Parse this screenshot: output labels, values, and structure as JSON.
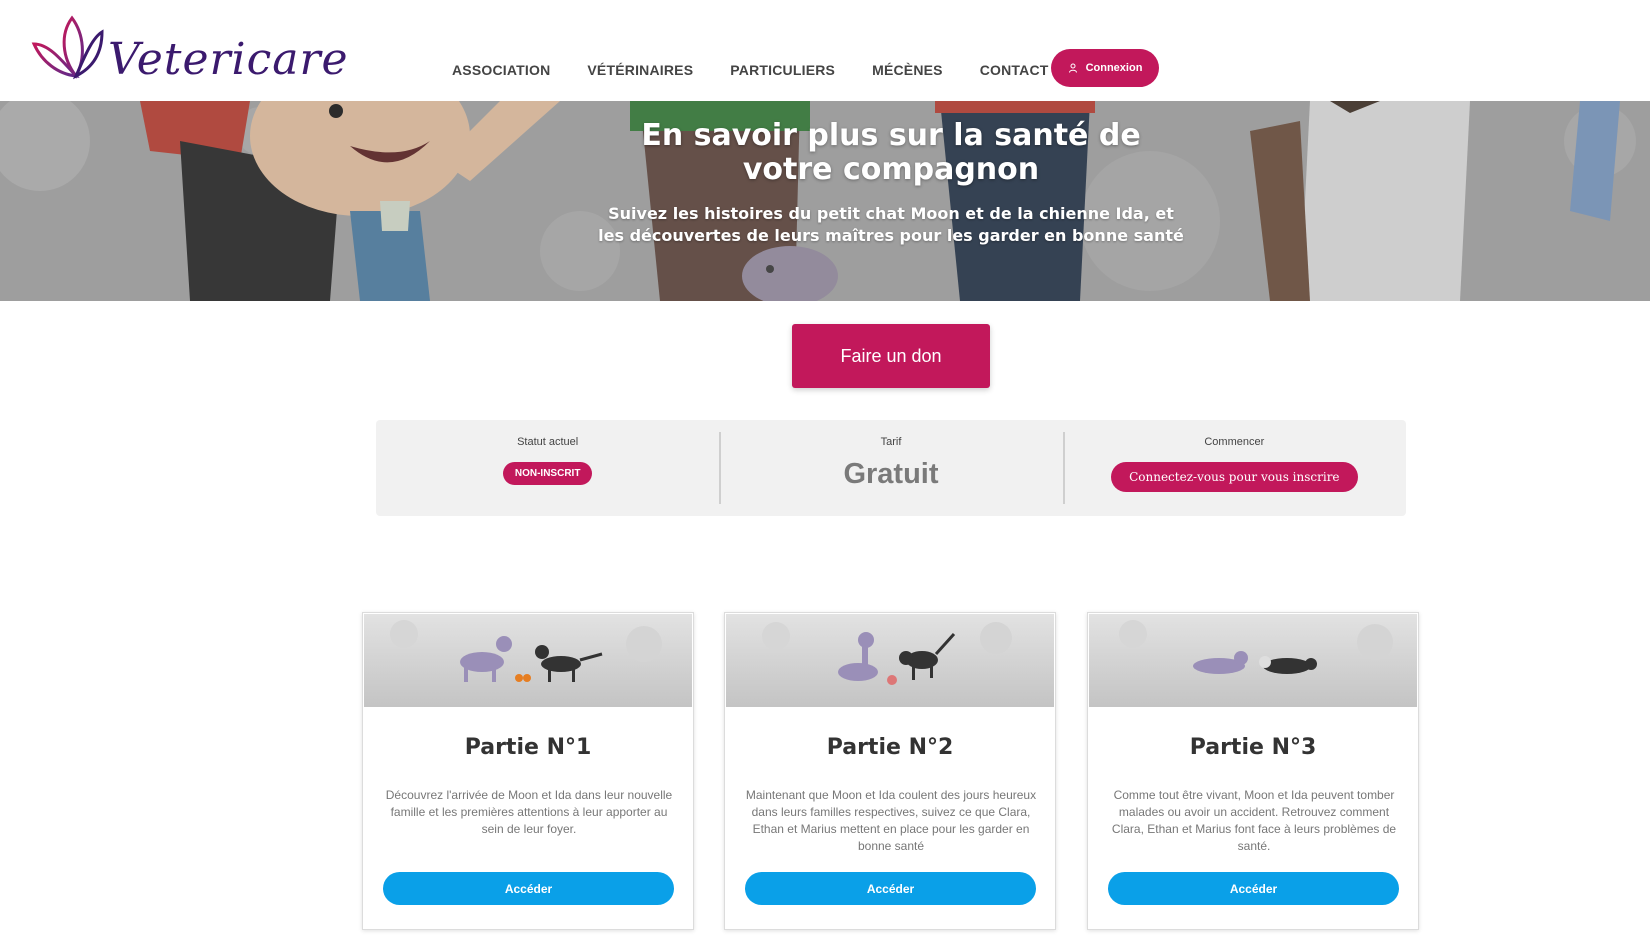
{
  "header": {
    "logo_text": "Vetericare",
    "nav": [
      {
        "label": "ASSOCIATION"
      },
      {
        "label": "VÉTÉRINAIRES"
      },
      {
        "label": "PARTICULIERS"
      },
      {
        "label": "MÉCÈNES"
      },
      {
        "label": "CONTACT"
      }
    ],
    "login_label": "Connexion",
    "login_icon": "user-icon"
  },
  "hero": {
    "title_line1": "En savoir plus sur la santé de",
    "title_line2": "votre compagnon",
    "subtitle_line1": "Suivez les histoires du petit chat Moon et de la chienne Ida, et",
    "subtitle_line2": "les découvertes de leurs maîtres pour les garder en bonne santé"
  },
  "donate_label": "Faire un don",
  "status": {
    "current_label": "Statut actuel",
    "current_badge": "NON-INSCRIT",
    "price_label": "Tarif",
    "price_value": "Gratuit",
    "start_label": "Commencer",
    "start_button": "Connectez-vous pour vous inscrire"
  },
  "cards": [
    {
      "title": "Partie N°1",
      "description": "Découvrez l'arrivée de Moon et Ida dans leur nouvelle famille et les premières attentions à leur apporter au sein de leur foyer.",
      "button": "Accéder"
    },
    {
      "title": "Partie N°2",
      "description": "Maintenant que Moon et Ida coulent des jours heureux dans leurs familles respectives, suivez ce que Clara, Ethan et Marius mettent en place pour les garder en bonne santé",
      "button": "Accéder"
    },
    {
      "title": "Partie N°3",
      "description": "Comme tout être vivant, Moon et Ida peuvent tomber malades ou avoir un accident. Retrouvez comment Clara, Ethan et Marius font face à leurs problèmes de santé.",
      "button": "Accéder"
    }
  ],
  "colors": {
    "brand_magenta": "#c2185b",
    "accent_blue": "#0aa0e8",
    "logo_purple": "#3b1a6e"
  }
}
